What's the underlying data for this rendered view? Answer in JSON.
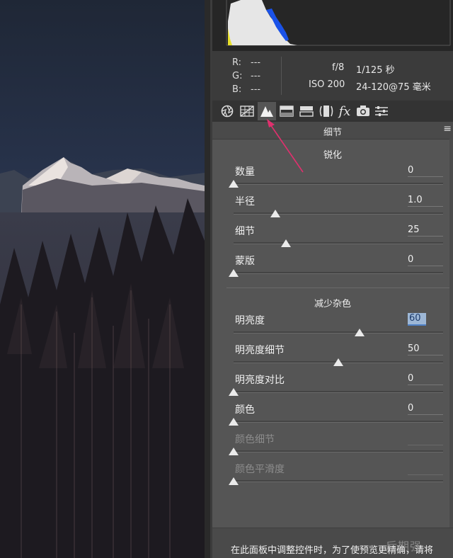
{
  "readout": {
    "r_label": "R:",
    "r_value": "---",
    "g_label": "G:",
    "g_value": "---",
    "b_label": "B:",
    "b_value": "---",
    "aperture": "f/8",
    "shutter": "1/125 秒",
    "iso": "ISO 200",
    "lens": "24-120@75 毫米"
  },
  "toolbar": {
    "icons": [
      "aperture-icon",
      "grid-icon",
      "detail-icon",
      "split-tone-icon",
      "bar-icon",
      "lens-icon",
      "fx-icon",
      "camera-icon",
      "sliders-icon"
    ],
    "fx_label": "fx",
    "active": "detail-icon"
  },
  "panel": {
    "title": "细节",
    "menu_glyph": "≡"
  },
  "sharpening": {
    "title": "锐化",
    "sliders": [
      {
        "label": "数量",
        "value": "0",
        "fraction": 0.0
      },
      {
        "label": "半径",
        "value": "1.0",
        "fraction": 0.2
      },
      {
        "label": "细节",
        "value": "25",
        "fraction": 0.25
      },
      {
        "label": "蒙版",
        "value": "0",
        "fraction": 0.0
      }
    ]
  },
  "noise_reduction": {
    "title": "减少杂色",
    "sliders": [
      {
        "label": "明亮度",
        "value": "60",
        "fraction": 0.6,
        "highlighted": true
      },
      {
        "label": "明亮度细节",
        "value": "50",
        "fraction": 0.5
      },
      {
        "label": "明亮度对比",
        "value": "0",
        "fraction": 0.0
      },
      {
        "label": "颜色",
        "value": "0",
        "fraction": 0.0
      },
      {
        "label": "颜色细节",
        "value": "",
        "fraction": 0.0,
        "disabled": true
      },
      {
        "label": "颜色平滑度",
        "value": "",
        "fraction": 0.0,
        "disabled": true
      }
    ]
  },
  "footer": {
    "note": "在此面板中调整控件时，为了使预览更精确，请将"
  },
  "watermark": "后期强",
  "colors": {
    "panel_bg": "#555555",
    "accent": "#4f80c6",
    "arrow": "#e0306e"
  }
}
